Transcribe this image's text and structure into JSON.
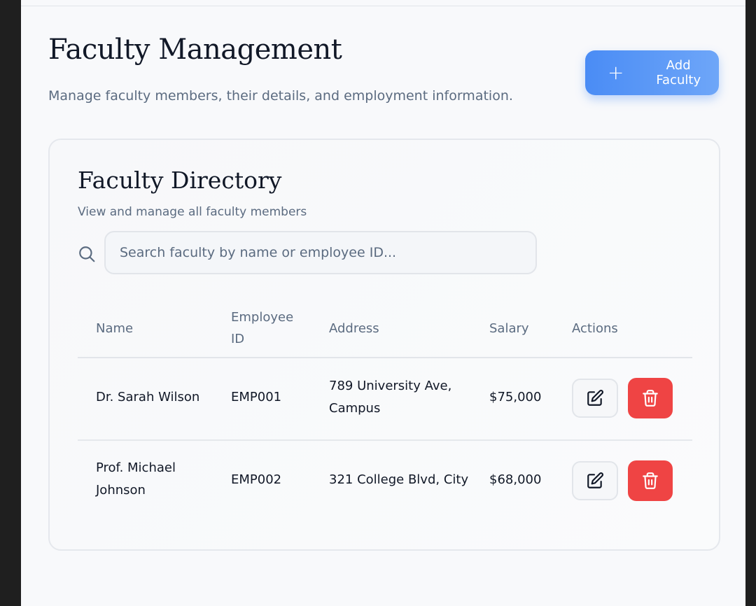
{
  "header": {
    "title": "Faculty Management",
    "subtitle": "Manage faculty members, their details, and employment information.",
    "add_button_label": "Add Faculty"
  },
  "directory": {
    "title": "Faculty Directory",
    "subtitle": "View and manage all faculty members",
    "search_placeholder": "Search faculty by name or employee ID...",
    "columns": [
      "Name",
      "Employee ID",
      "Address",
      "Salary",
      "Actions"
    ],
    "rows": [
      {
        "name": "Dr. Sarah Wilson",
        "employee_id": "EMP001",
        "address": "789 University Ave, Campus",
        "salary": "$75,000"
      },
      {
        "name": "Prof. Michael Johnson",
        "employee_id": "EMP002",
        "address": "321 College Blvd, City",
        "salary": "$68,000"
      }
    ]
  },
  "icons": {
    "search": "search-icon",
    "add": "plus-icon",
    "edit": "edit-icon",
    "delete": "trash-icon"
  },
  "colors": {
    "accent": "#4a8cf5",
    "danger": "#ef4444"
  }
}
